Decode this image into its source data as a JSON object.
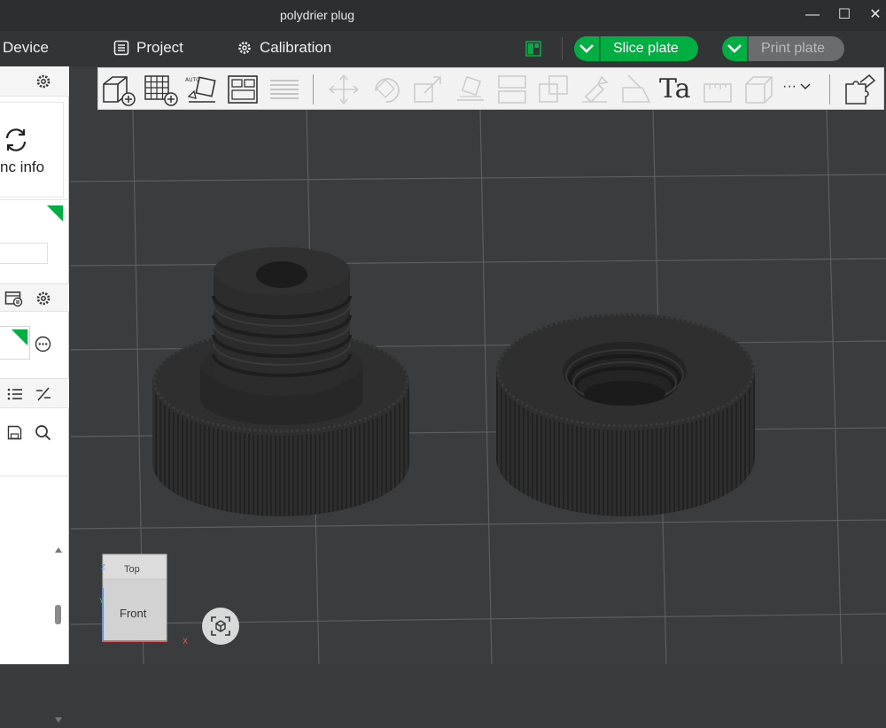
{
  "window": {
    "title": "polydrier plug",
    "controls": {
      "minimize": "—",
      "maximize": "☐",
      "close": "✕"
    }
  },
  "menubar": {
    "device_label": "Device",
    "project_label": "Project",
    "calibration_label": "Calibration",
    "slice_label": "Slice plate",
    "print_label": "Print plate"
  },
  "sidebar": {
    "sync_label": "nc info"
  },
  "viewcube": {
    "top_label": "Top",
    "front_label": "Front",
    "axis_x": "X",
    "axis_y": "Y",
    "axis_z": "Z"
  },
  "toolbar": {
    "icons": [
      "add-object-icon",
      "add-plate-icon",
      "auto-orient-icon",
      "arrange-icon",
      "layers-icon",
      "move-icon",
      "rotate-icon",
      "scale-icon",
      "lay-on-face-icon",
      "split-icon",
      "cut-icon",
      "support-paint-icon",
      "seam-paint-icon",
      "text-icon",
      "measure-icon",
      "assembly-icon",
      "more-icon",
      "puzzle-icon"
    ],
    "text_tool_label": "Ta",
    "more_label": "···"
  },
  "colors": {
    "accent": "#00ae42",
    "titlebar": "#2d2e30",
    "menubar": "#333436",
    "viewport": "#3a3b3c",
    "disabled": "#6b6c6e"
  }
}
